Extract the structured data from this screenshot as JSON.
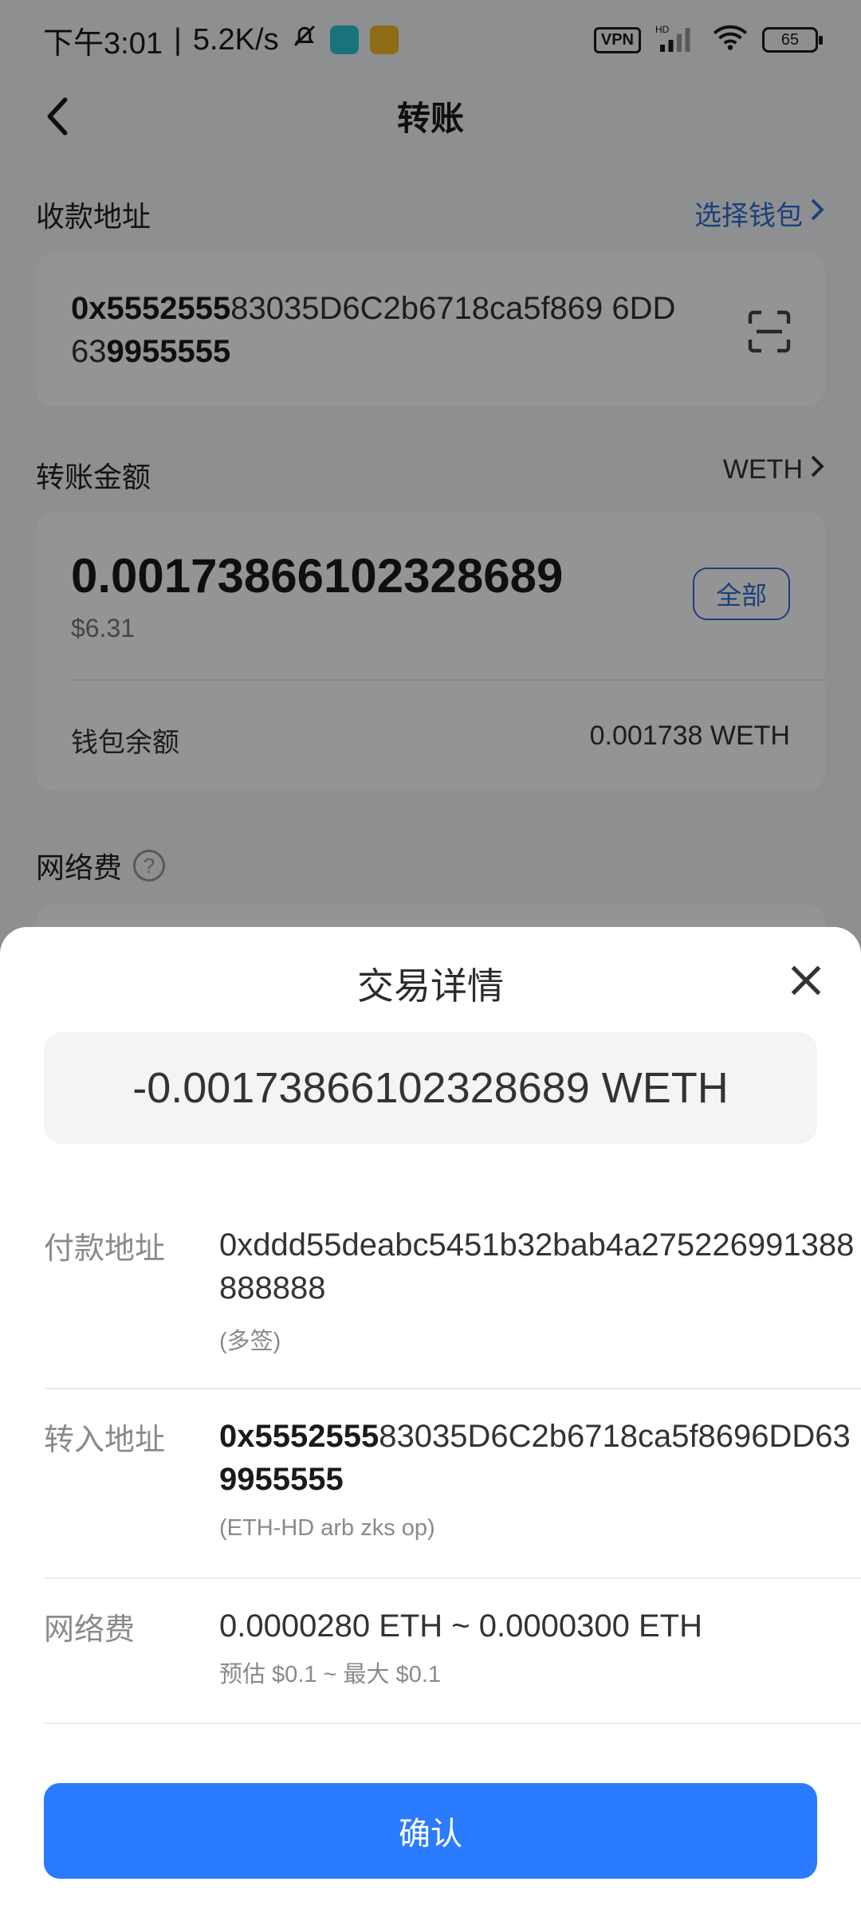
{
  "status_bar": {
    "time_prefix": "下午3:01",
    "separator": "|",
    "speed": "5.2K/s",
    "vpn": "VPN",
    "hd": "HD",
    "battery": "65"
  },
  "nav": {
    "title": "转账"
  },
  "recipient": {
    "label": "收款地址",
    "select_wallet": "选择钱包",
    "address_bold_start": "0x5552555",
    "address_middle": "83035D6C2b6718ca5f869 6DD63",
    "address_bold_end": "9955555"
  },
  "amount": {
    "label": "转账金额",
    "token": "WETH",
    "value": "0.00173866102328689",
    "usd": "$6.31",
    "all_button": "全部",
    "balance_label": "钱包余额",
    "balance_value": "0.001738 WETH"
  },
  "fee_section": {
    "label": "网络费",
    "help": "?"
  },
  "sheet": {
    "title": "交易详情",
    "amount": "-0.00173866102328689 WETH",
    "from": {
      "label": "付款地址",
      "address": "0xddd55deabc5451b32bab4a275226991388888888",
      "note": "(多签)"
    },
    "to": {
      "label": "转入地址",
      "address_bold_start": "0x5552555",
      "address_middle": "83035D6C2b6718ca5f8696DD63",
      "address_bold_end": "9955555",
      "note": "(ETH-HD arb zks op)"
    },
    "fee": {
      "label": "网络费",
      "value": "0.0000280 ETH ~ 0.0000300 ETH",
      "estimate": "预估 $0.1 ~ 最大 $0.1"
    },
    "confirm": "确认"
  },
  "colors": {
    "accent": "#2a7bff",
    "link": "#2f6fd8",
    "overlay": "rgba(0,0,0,0.42)"
  }
}
